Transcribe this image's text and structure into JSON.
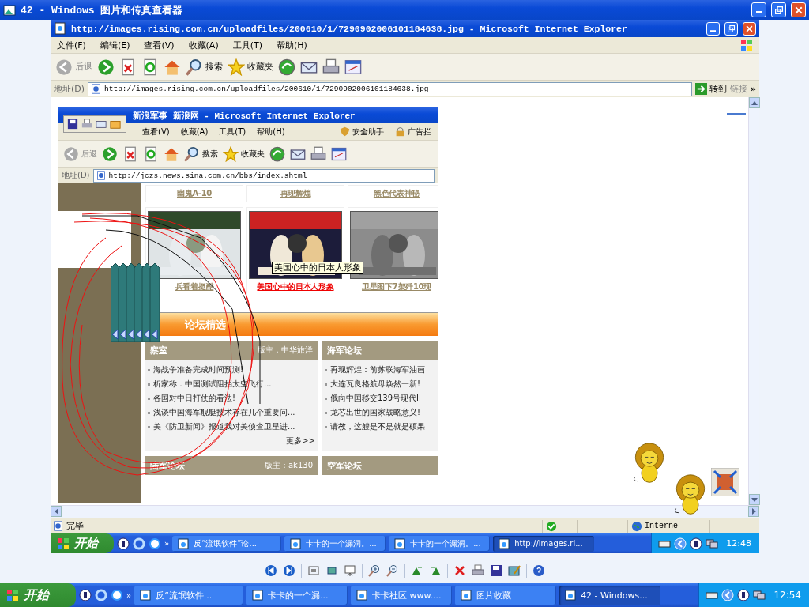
{
  "viewer": {
    "title": "42 - Windows 图片和传真查看器"
  },
  "ie": {
    "title": "http://images.rising.com.cn/uploadfiles/200610/1/7290902006101184638.jpg - Microsoft Internet Explorer",
    "menu": [
      "文件(F)",
      "编辑(E)",
      "查看(V)",
      "收藏(A)",
      "工具(T)",
      "帮助(H)"
    ],
    "toolbar": [
      {
        "kind": "back",
        "label": "后退"
      },
      {
        "kind": "forward"
      },
      {
        "kind": "stop"
      },
      {
        "kind": "refresh"
      },
      {
        "kind": "home"
      },
      {
        "kind": "search",
        "label": "搜索"
      },
      {
        "kind": "favorites",
        "label": "收藏夹"
      },
      {
        "kind": "media"
      },
      {
        "kind": "mail"
      },
      {
        "kind": "print"
      },
      {
        "kind": "edit"
      }
    ],
    "address_label": "地址(D)",
    "url": "http://images.rising.com.cn/uploadfiles/200610/1/7290902006101184638.jpg",
    "go": "转到",
    "links": "链接",
    "links_more": "»",
    "status": "完毕",
    "zone": "Interne",
    "taskbar": {
      "start": "开始",
      "more": "»",
      "tasks": [
        {
          "label": "反“流氓软件”论...",
          "selected": false
        },
        {
          "label": "卡卡的一个漏洞。...",
          "selected": false
        },
        {
          "label": "卡卡的一个漏洞。...",
          "selected": false
        },
        {
          "label": "http://images.ri...",
          "selected": true
        }
      ],
      "clock": "12:48"
    }
  },
  "sina": {
    "title": "新浪军事_新浪网 - Microsoft Internet Explorer",
    "menu": [
      "查看(V)",
      "收藏(A)",
      "工具(T)",
      "帮助(H)"
    ],
    "safety": "安全助手",
    "adblock": "广告拦",
    "toolbar": [
      {
        "kind": "back",
        "label": "后退"
      },
      {
        "kind": "forward"
      },
      {
        "kind": "stop"
      },
      {
        "kind": "refresh"
      },
      {
        "kind": "home"
      },
      {
        "kind": "search",
        "label": "搜索"
      },
      {
        "kind": "favorites",
        "label": "收藏夹"
      },
      {
        "kind": "media"
      },
      {
        "kind": "mail"
      },
      {
        "kind": "print"
      },
      {
        "kind": "edit"
      }
    ],
    "address_label": "地址(D)",
    "url": "http://jczs.news.sina.com.cn/bbs/index.shtml",
    "top_captions": [
      "幽鬼A-10",
      "再现辉煌",
      "黑色代表神秘"
    ],
    "photos": [
      {
        "caption": "兵看着挺酷",
        "highlighted": false
      },
      {
        "caption": "美国心中的日本人形象",
        "highlighted": true
      },
      {
        "caption": "卫星图下7架歼10现",
        "highlighted": false
      }
    ],
    "tooltip": "美国心中的日本人形象",
    "section_title": "论坛精选",
    "forums": [
      {
        "name": "察室",
        "moderator": "版主：中华旅洋",
        "items": [
          "海战争准备完成时间预测!",
          "析家称：中国测试阻挡太空飞行...",
          "各国对中日打仗的看法!",
          "浅谈中国海军舰艇技术存在几个重要问...",
          "美《防卫新闻》报道我对美侦查卫星进..."
        ],
        "more": "更多>>"
      },
      {
        "name": "海军论坛",
        "items": [
          "再现辉煌：前苏联海军油画",
          "大连瓦良格航母焕然一新!",
          "俄向中国移交139号现代II",
          "龙芯出世的国家战略意义!",
          "请教，这艘是不是就是硕果"
        ]
      }
    ],
    "forums_next": [
      {
        "name": "陆军论坛",
        "moderator": "版主：ak130"
      },
      {
        "name": "空军论坛"
      }
    ]
  },
  "taskbar": {
    "start": "开始",
    "more": "»",
    "tasks": [
      {
        "label": "反“流氓软件...",
        "selected": false
      },
      {
        "label": "卡卡的一个漏...",
        "selected": false
      },
      {
        "label": "卡卡社区 www....",
        "selected": false
      },
      {
        "label": "图片收藏",
        "selected": false
      },
      {
        "label": "42 - Windows...",
        "selected": true
      }
    ],
    "clock": "12:54"
  }
}
